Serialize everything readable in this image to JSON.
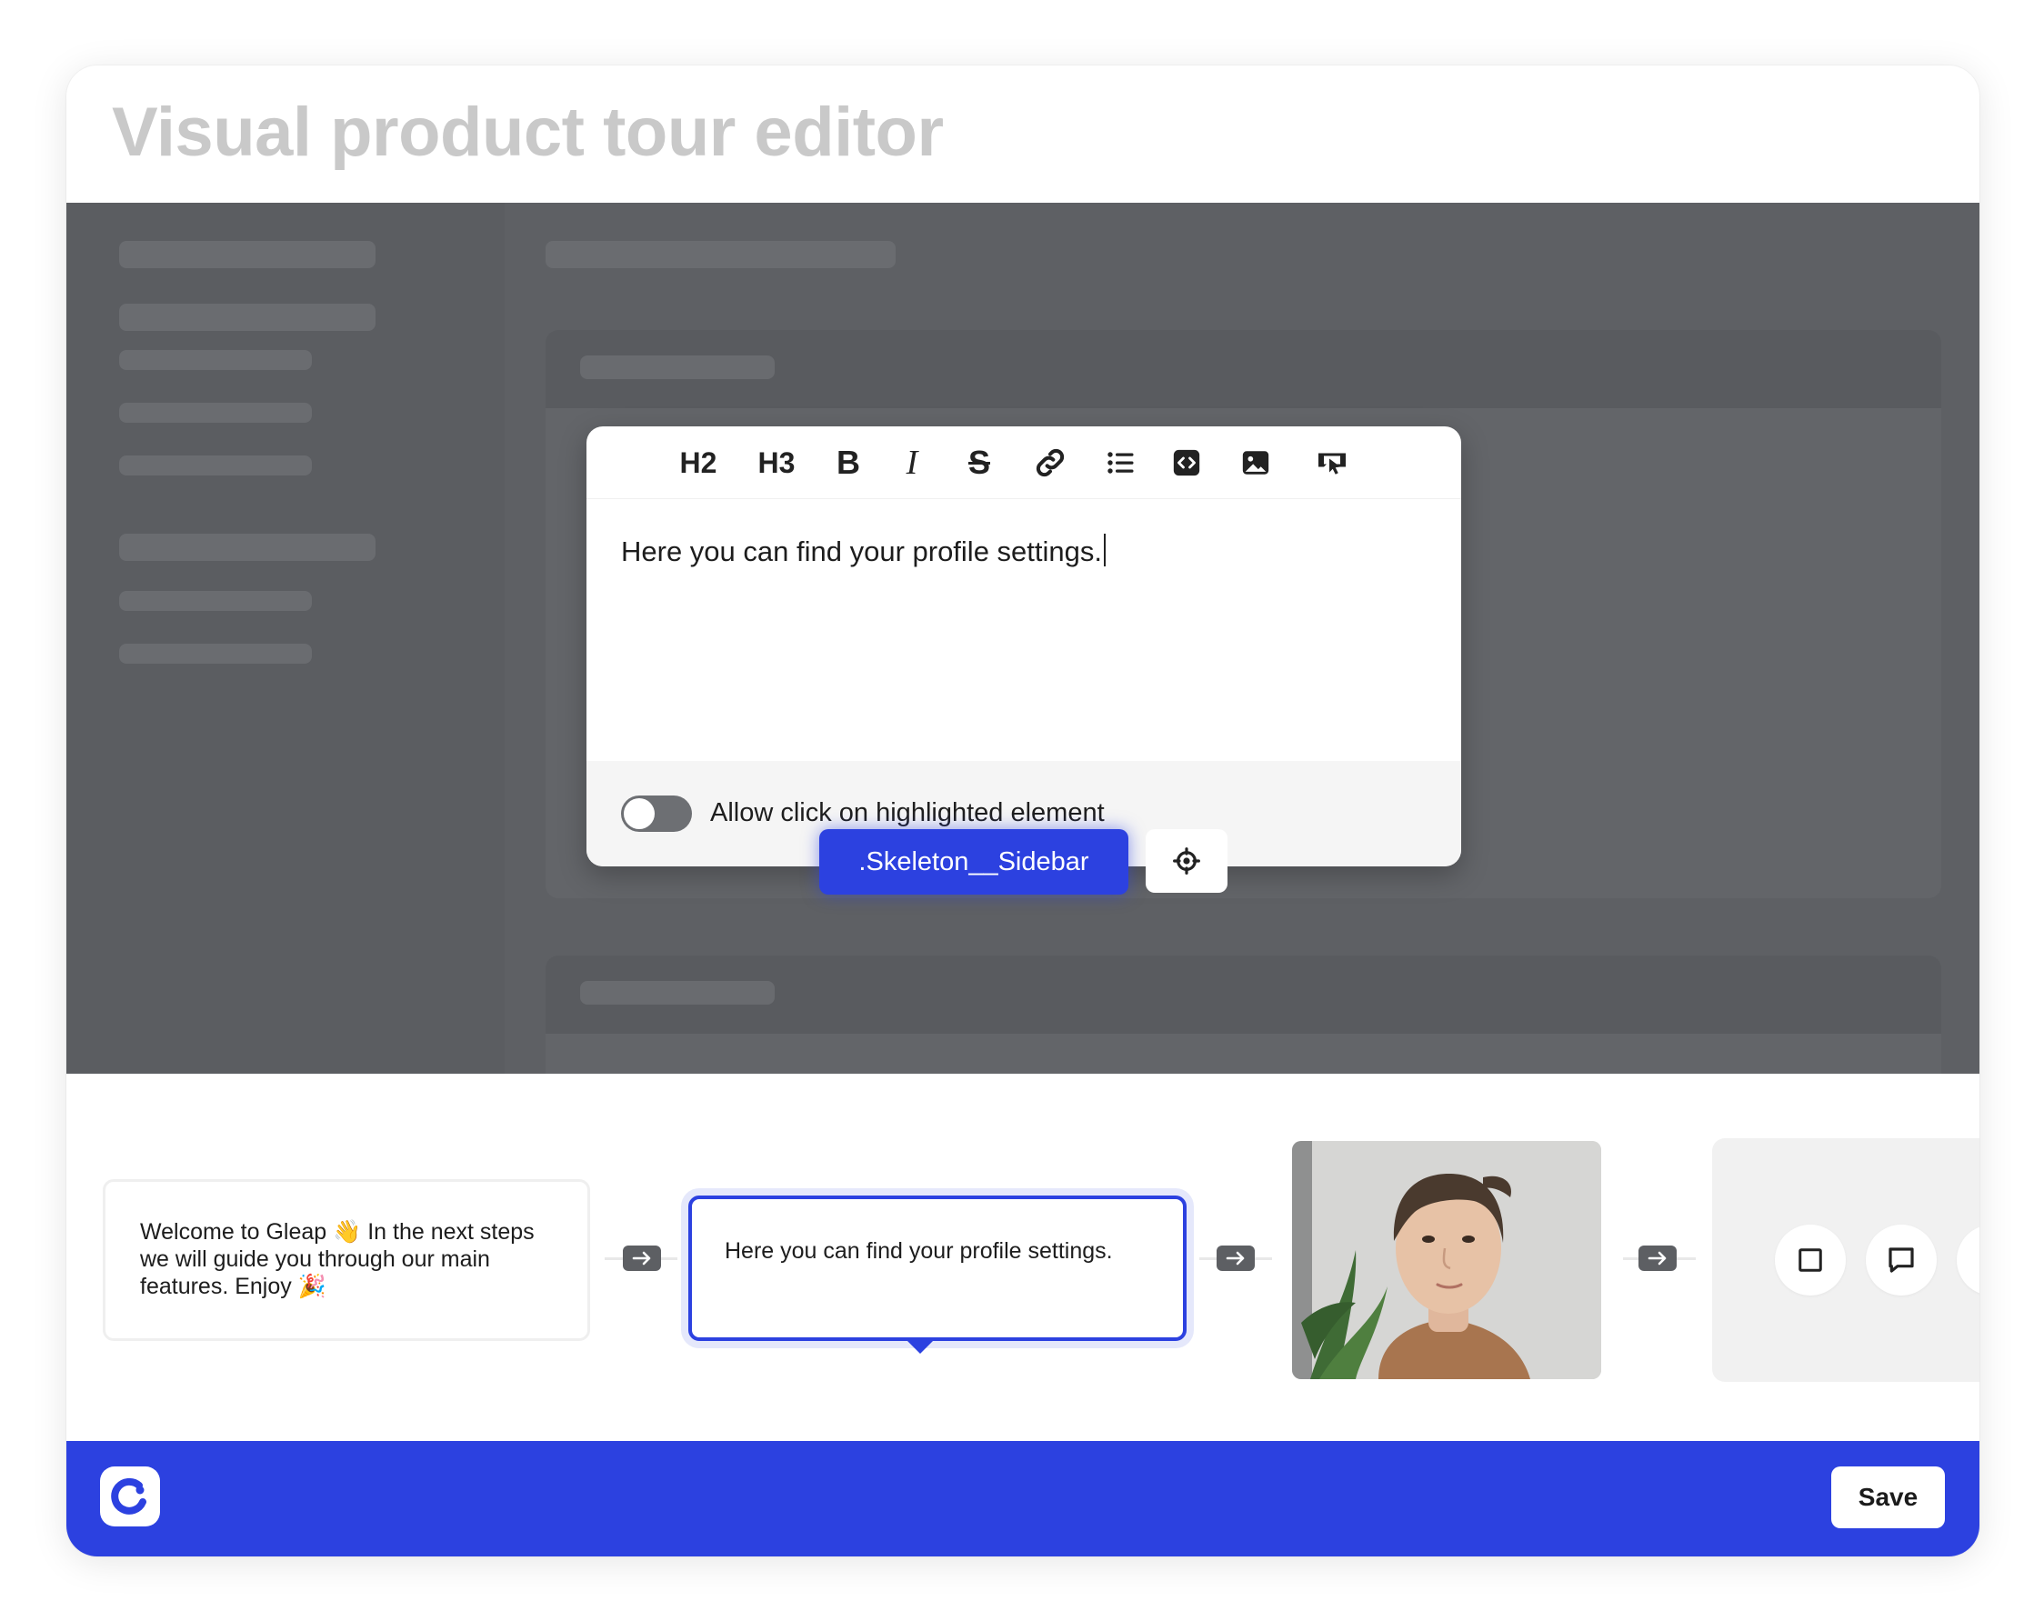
{
  "page": {
    "title": "Visual product tour editor"
  },
  "editor": {
    "toolbar": {
      "h2": "H2",
      "h3": "H3",
      "bold": "B",
      "italic": "I",
      "strike": "S"
    },
    "content": "Here you can find your profile settings.",
    "allow_click_label": "Allow click on highlighted element",
    "allow_click_enabled": false
  },
  "selector": {
    "label": ".Skeleton__Sidebar"
  },
  "steps": {
    "step1_text": "Welcome to Gleap 👋 In the next steps we will guide you through our main features. Enjoy 🎉",
    "step2_text": "Here you can find your profile settings."
  },
  "footer": {
    "save_label": "Save"
  },
  "colors": {
    "accent": "#2c41e0",
    "overlay": "#5e6064"
  }
}
